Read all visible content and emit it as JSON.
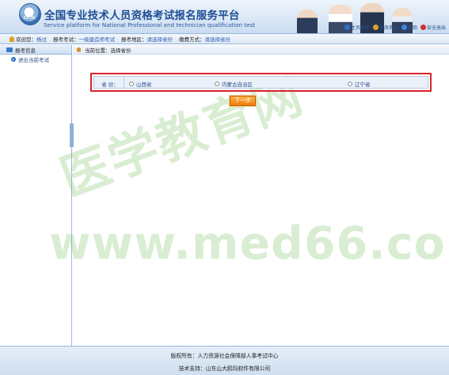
{
  "header": {
    "title_cn": "全国专业技术人员资格考试报名服务平台",
    "title_en": "Service platform for National Professional and technician qualification test",
    "logo_text": "CPTA",
    "utils": [
      {
        "label": "主页维护",
        "icon": "home-maintenance-icon",
        "color": "#2a73c8"
      },
      {
        "label": "修改密码",
        "icon": "lock-icon",
        "color": "#e0a030"
      },
      {
        "label": "帮助",
        "icon": "help-icon",
        "color": "#3a8bd8"
      },
      {
        "label": "安全退出",
        "icon": "power-icon",
        "color": "#d83030"
      }
    ]
  },
  "infobar": {
    "welcome_label": "欢迎您：",
    "user_name": "杨过",
    "exam_label": "报考考试：",
    "exam_value": "一级建造师考试",
    "region_label": "报考地区：",
    "region_value": "请选择省份",
    "payment_label": "缴费方式：",
    "payment_value": "请选择省份"
  },
  "sidebar": {
    "header": "报考信息",
    "items": [
      {
        "label": "进出当前考试"
      }
    ]
  },
  "breadcrumb": {
    "text": "当前位置：选择省份"
  },
  "province_select": {
    "label": "省  份：",
    "options": [
      {
        "label": "山西省"
      },
      {
        "label": "内蒙古自治区"
      },
      {
        "label": "辽宁省"
      }
    ]
  },
  "next_button": {
    "label": "下一步"
  },
  "watermark": {
    "line1": "医学教育网",
    "line2": "www.med66.com"
  },
  "footer": {
    "copyright": "版权所有：人力资源社会保障部人事考试中心",
    "support": "技术支持：山东山大鸥玛软件有限公司"
  },
  "colors": {
    "brand_blue": "#1f4f95",
    "highlight_red": "#d8242a",
    "button_orange": "#f07d10",
    "watermark_green": "#76be5c"
  }
}
